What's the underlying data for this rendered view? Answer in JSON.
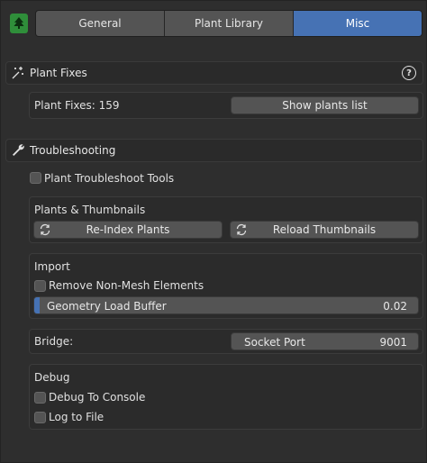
{
  "tabs": [
    {
      "label": "General",
      "active": false
    },
    {
      "label": "Plant Library",
      "active": false
    },
    {
      "label": "Misc",
      "active": true
    }
  ],
  "plant_fixes": {
    "title": "Plant Fixes",
    "count_label": "Plant Fixes: 159",
    "show_button": "Show plants list"
  },
  "troubleshooting": {
    "title": "Troubleshooting",
    "tools_checkbox": "Plant Troubleshoot Tools",
    "plants_thumbs": {
      "title": "Plants & Thumbnails",
      "reindex_button": "Re-Index Plants",
      "reload_button": "Reload Thumbnails"
    },
    "import": {
      "title": "Import",
      "remove_checkbox": "Remove Non-Mesh Elements",
      "buffer_label": "Geometry Load Buffer",
      "buffer_value": "0.02",
      "buffer_fraction": 0.02
    },
    "bridge": {
      "label": "Bridge:",
      "port_label": "Socket Port",
      "port_value": "9001"
    },
    "debug": {
      "title": "Debug",
      "console_checkbox": "Debug To Console",
      "log_checkbox": "Log to File"
    }
  },
  "colors": {
    "accent": "#4672b4",
    "app_icon": "#2f8e3a"
  },
  "icons": [
    "tree-icon",
    "sparkles-icon",
    "help-icon",
    "wrench-icon",
    "refresh-icon"
  ]
}
